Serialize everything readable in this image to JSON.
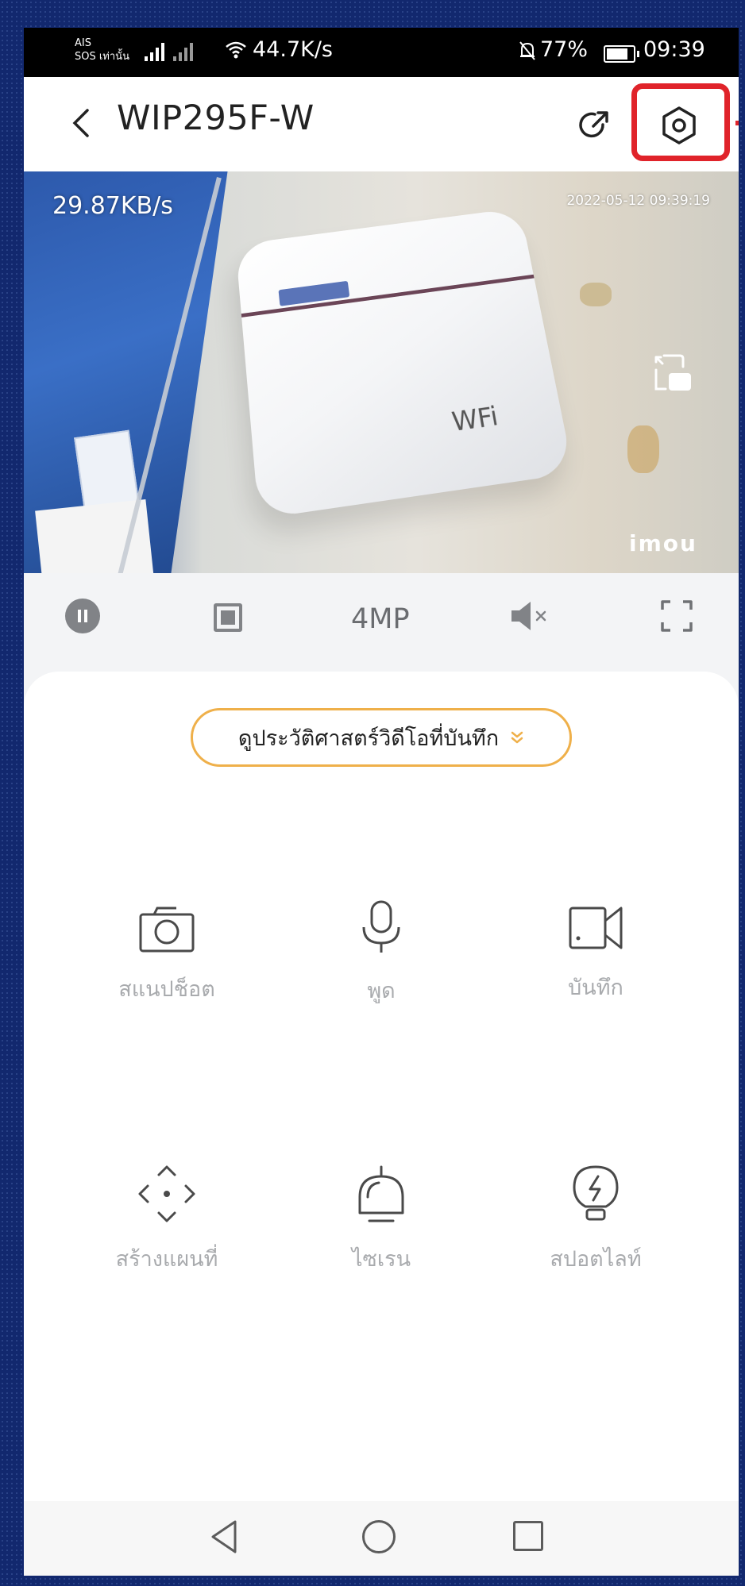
{
  "status_bar": {
    "carrier_line1": "AIS",
    "carrier_line2": "SOS เท่านั้น",
    "network_speed": "44.7K/s",
    "battery": "77%",
    "time": "09:39"
  },
  "header": {
    "title": "WIP295F-W",
    "back_icon": "chevron-left-icon",
    "share_icon": "share-icon",
    "settings_icon": "settings-hexagon-icon",
    "highlight_color": "#e0232a"
  },
  "video": {
    "bitrate": "29.87KB/s",
    "timestamp": "2022-05-12 09:39:19",
    "device_logo": "WFi",
    "watermark": "imou"
  },
  "controls": {
    "quality": "4MP",
    "icons": [
      "pause-icon",
      "stop-icon",
      "mute-icon",
      "fullscreen-icon"
    ]
  },
  "panel": {
    "history_button": "ดูประวัติศาสตร์วิดีโอที่บันทึก",
    "accent_color": "#efb04a",
    "features": [
      {
        "label": "สแนปช็อต",
        "icon": "camera-icon"
      },
      {
        "label": "พูด",
        "icon": "microphone-icon"
      },
      {
        "label": "บันทึก",
        "icon": "video-record-icon"
      },
      {
        "label": "สร้างแผนที่",
        "icon": "ptz-direction-icon"
      },
      {
        "label": "ไซเรน",
        "icon": "siren-icon"
      },
      {
        "label": "สปอตไลท์",
        "icon": "spotlight-icon"
      }
    ]
  },
  "navbar": {
    "icons": [
      "nav-back-icon",
      "nav-home-icon",
      "nav-recent-icon"
    ]
  }
}
